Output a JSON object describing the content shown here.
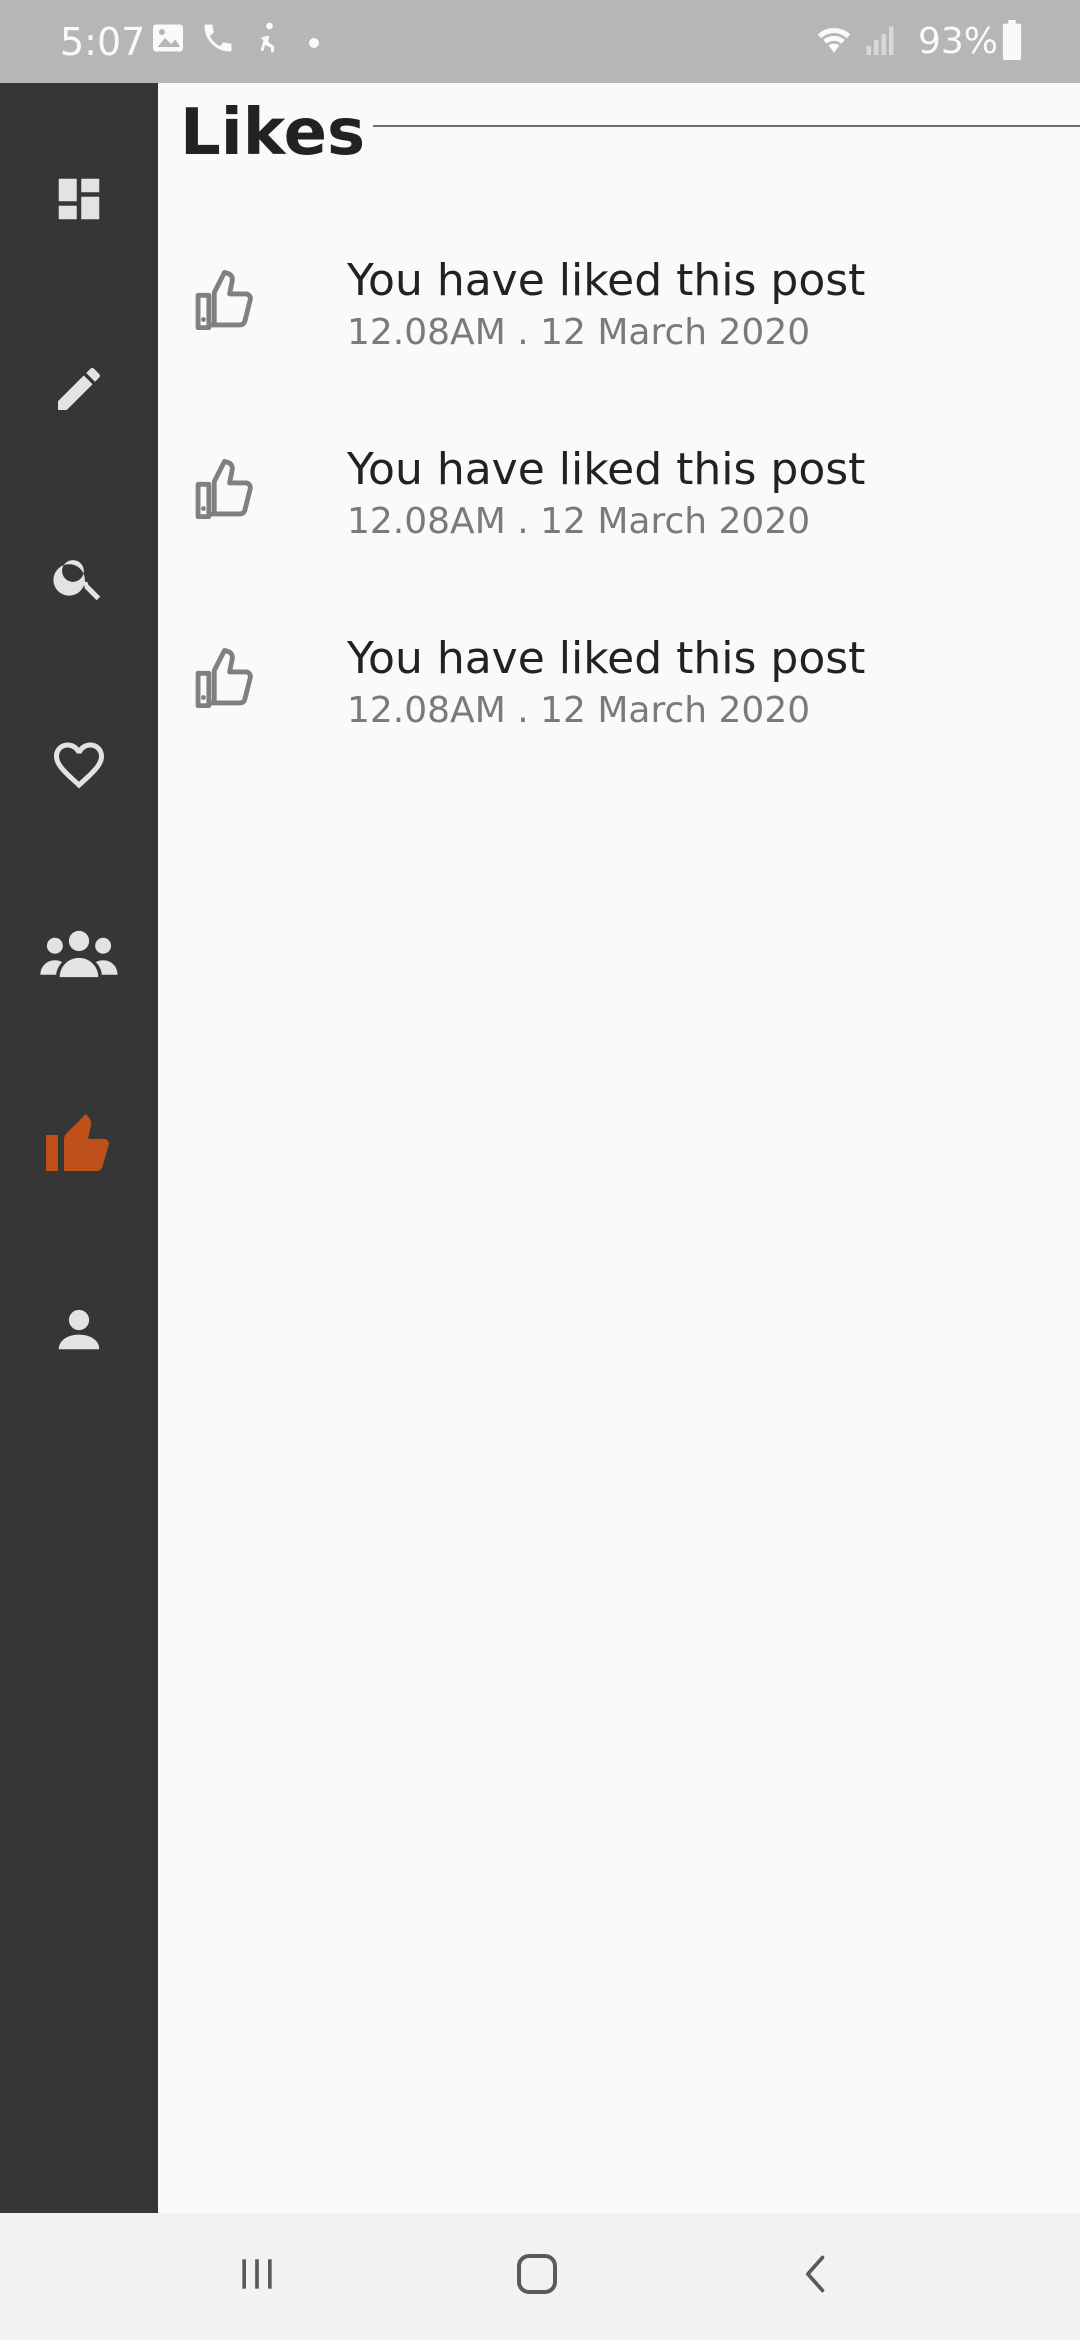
{
  "status_bar": {
    "time": "5:07",
    "battery": "93%",
    "icons": [
      "image-icon",
      "phone-icon",
      "accessibility-icon",
      "dot-icon",
      "wifi-icon",
      "signal-icon",
      "battery-icon"
    ]
  },
  "sidebar": {
    "items": [
      {
        "name": "dashboard",
        "icon": "dashboard-icon",
        "active": false
      },
      {
        "name": "edit",
        "icon": "pencil-icon",
        "active": false
      },
      {
        "name": "search",
        "icon": "search-icon",
        "active": false
      },
      {
        "name": "favorites",
        "icon": "heart-icon",
        "active": false
      },
      {
        "name": "groups",
        "icon": "people-icon",
        "active": false
      },
      {
        "name": "likes",
        "icon": "thumbs-up-icon",
        "active": true
      },
      {
        "name": "profile",
        "icon": "person-icon",
        "active": false
      }
    ],
    "active_color": "#c0501a",
    "icon_color": "#e3e3e3"
  },
  "main": {
    "title": "Likes",
    "likes": [
      {
        "text": "You have liked this post",
        "meta": "12.08AM . 12 March 2020"
      },
      {
        "text": "You have liked this post",
        "meta": "12.08AM . 12 March 2020"
      },
      {
        "text": "You have liked this post",
        "meta": "12.08AM . 12 March 2020"
      }
    ]
  },
  "system_nav": {
    "buttons": [
      "recent-apps-icon",
      "home-icon",
      "back-icon"
    ]
  }
}
